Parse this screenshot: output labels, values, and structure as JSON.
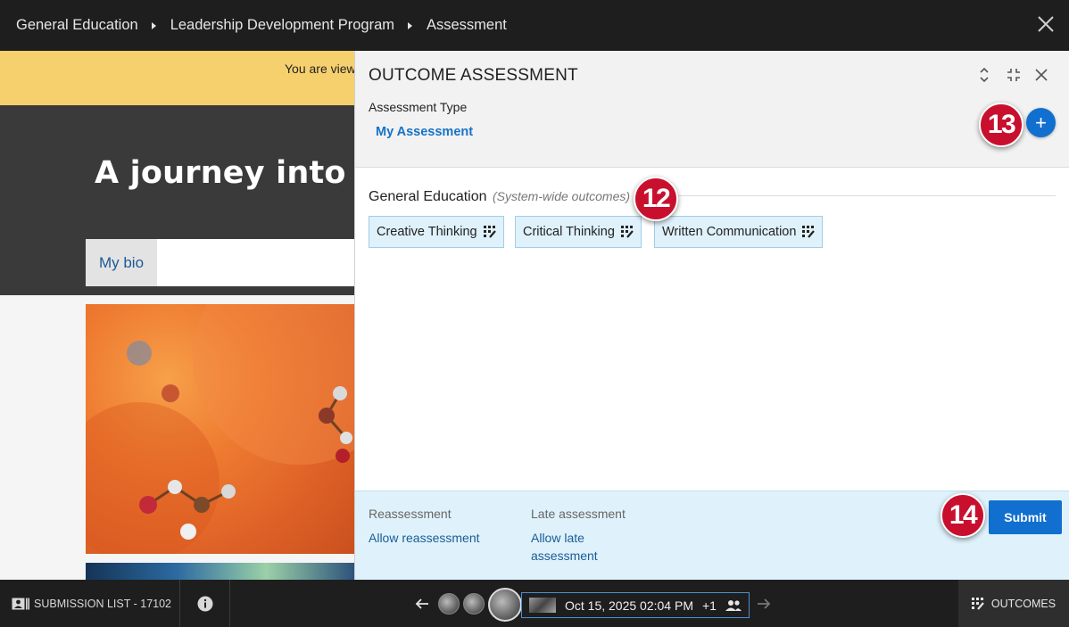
{
  "topbar": {
    "breadcrumbs": [
      "General Education",
      "Leadership Development Program",
      "Assessment"
    ]
  },
  "background_page": {
    "banner_text": "You are view",
    "hero_title": "A journey into m",
    "bio_tab": "My bio"
  },
  "panel": {
    "title": "OUTCOME ASSESSMENT",
    "assessment_type_label": "Assessment Type",
    "assessment_type_value": "My Assessment",
    "add_label": "+",
    "section_title": "General Education",
    "section_subtitle": "(System-wide outcomes)",
    "chips": [
      "Creative Thinking",
      "Critical Thinking",
      "Written Communication"
    ],
    "footer": {
      "reassessment_label": "Reassessment",
      "reassessment_link": "Allow reassessment",
      "late_label": "Late assessment",
      "late_link": "Allow late assessment",
      "submit_label": "Submit"
    }
  },
  "callouts": [
    "12",
    "13",
    "14"
  ],
  "bottombar": {
    "submission_list": "SUBMISSION LIST - 17102",
    "date": "Oct 15, 2025 02:04 PM",
    "more_count": "+1",
    "outcomes_label": "OUTCOMES"
  },
  "colors": {
    "accent": "#1170cf",
    "banner": "#f7d06e",
    "callout": "#c8102e",
    "chip_bg": "#dff1fb",
    "footer_bg": "#dff2fb",
    "dark_bar": "#1e1e1e"
  }
}
